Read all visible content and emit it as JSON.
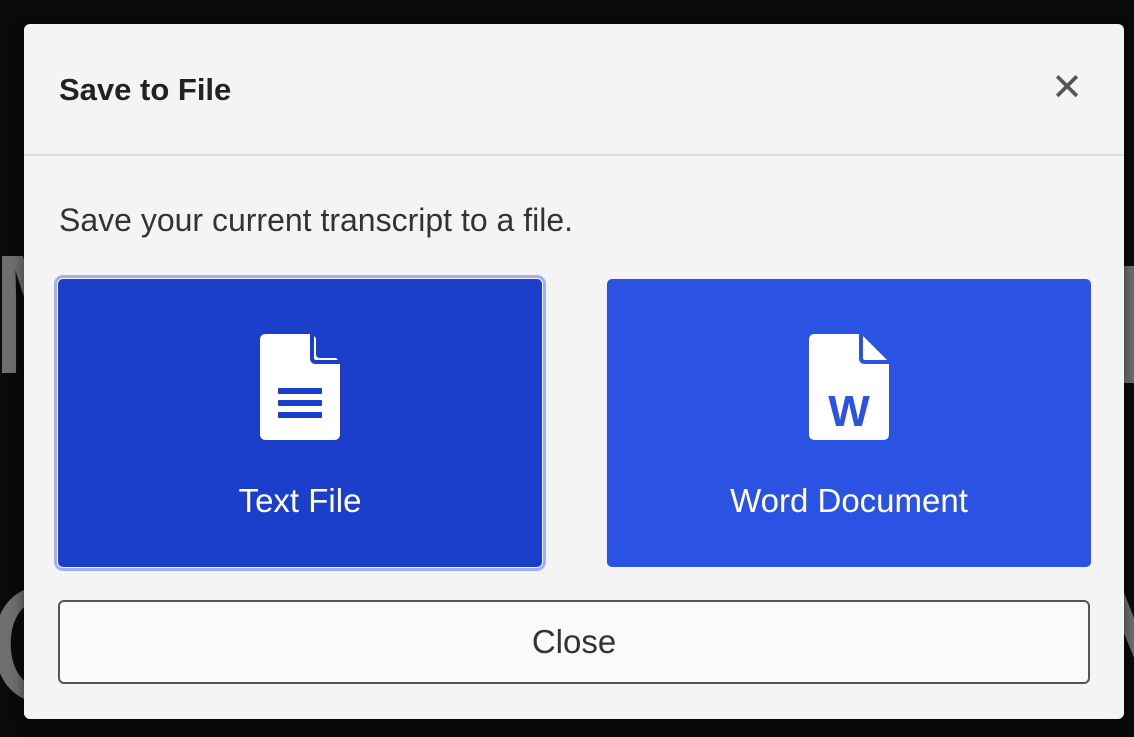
{
  "dialog": {
    "title": "Save to File",
    "close_icon": "close-x-icon",
    "description": "Save your current transcript to a file.",
    "options": [
      {
        "label": "Text File",
        "icon": "text-document-icon",
        "selected": true
      },
      {
        "label": "Word Document",
        "icon": "word-document-icon",
        "icon_letter": "W",
        "selected": false
      }
    ],
    "close_button_label": "Close"
  },
  "colors": {
    "dialog_bg": "#f4f4f4",
    "text_file_bg": "#1b3fcb",
    "word_doc_bg": "#2a52e3",
    "focus_ring": "#9fb1f2",
    "backdrop": "#0a0a0a"
  }
}
